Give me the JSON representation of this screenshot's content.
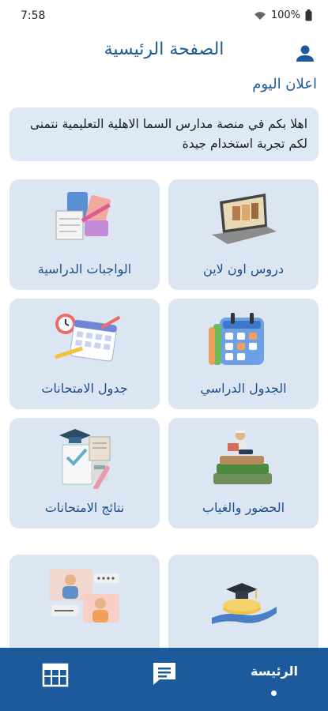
{
  "status_bar": {
    "time": "7:58",
    "battery": "100%"
  },
  "header": {
    "title": "الصفحة الرئيسية"
  },
  "announcement": {
    "title": "اعلان اليوم",
    "text": "اهلا بكم في منصة مدارس السما الاهلية التعليمية نتمنى لكم تجربة استخدام جيدة"
  },
  "cards": [
    {
      "label": "دروس اون لاين",
      "icon": "laptop-books-icon"
    },
    {
      "label": "الواجبات الدراسية",
      "icon": "homework-books-icon"
    },
    {
      "label": "الجدول الدراسي",
      "icon": "calendar-icon"
    },
    {
      "label": "جدول الامتحانات",
      "icon": "alarm-calendar-icon"
    },
    {
      "label": "الحضور والغياب",
      "icon": "student-reading-icon"
    },
    {
      "label": "نتائج الامتحانات",
      "icon": "graduation-results-icon"
    },
    {
      "label": "",
      "icon": "graduation-coins-icon"
    },
    {
      "label": "",
      "icon": "video-call-icon"
    }
  ],
  "bottom_nav": {
    "home_label": "الرئيسة",
    "accent": "#1c5a9c"
  }
}
